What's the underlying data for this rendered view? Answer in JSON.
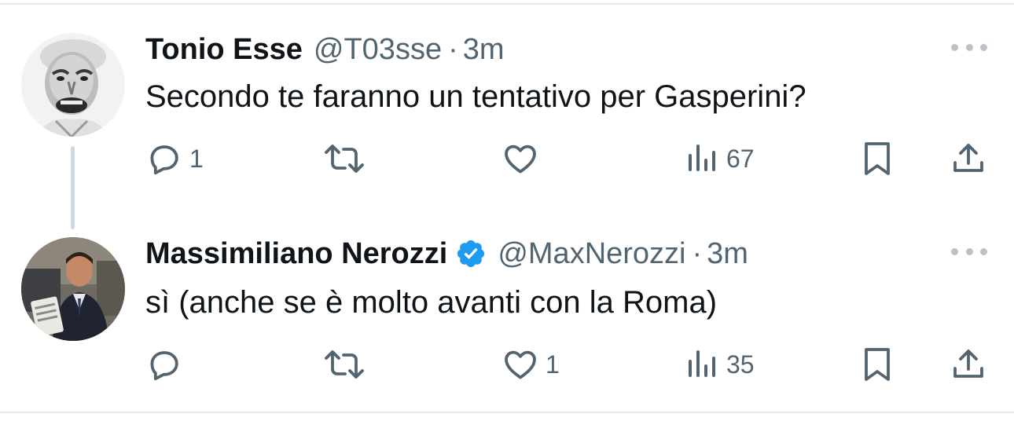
{
  "tweets": [
    {
      "author": {
        "name": "Tonio Esse",
        "handle": "@T03sse",
        "verified": false
      },
      "separator": "·",
      "time": "3m",
      "text": "Secondo te faranno un tentativo per Gasperini?",
      "stats": {
        "replies": "1",
        "retweets": "",
        "likes": "",
        "views": "67"
      }
    },
    {
      "author": {
        "name": "Massimiliano Nerozzi",
        "handle": "@MaxNerozzi",
        "verified": true
      },
      "separator": "·",
      "time": "3m",
      "text": "sì (anche se è molto avanti con la Roma)",
      "stats": {
        "replies": "",
        "retweets": "",
        "likes": "1",
        "views": "35"
      }
    }
  ],
  "colors": {
    "text_primary": "#0f1419",
    "text_secondary": "#536471",
    "verified_badge": "#1d9bf0",
    "thread_line": "#cfd9de",
    "divider": "#e7e9ea"
  },
  "icons": [
    "reply-icon",
    "retweet-icon",
    "like-icon",
    "views-icon",
    "bookmark-icon",
    "share-icon",
    "more-icon",
    "verified-badge-icon"
  ]
}
